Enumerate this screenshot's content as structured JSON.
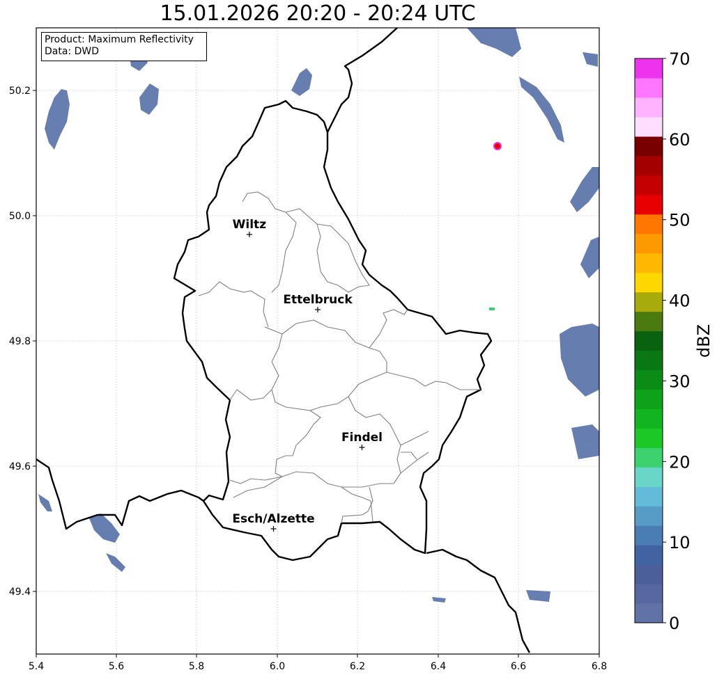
{
  "title": "15.01.2026 20:20 - 20:24 UTC",
  "info": {
    "product": "Product: Maximum Reflectivity",
    "data": "Data: DWD"
  },
  "map": {
    "xlim": [
      5.4,
      6.8
    ],
    "ylim": [
      49.3,
      50.3
    ],
    "x_ticks": [
      "5.4",
      "5.6",
      "5.8",
      "6.0",
      "6.2",
      "6.4",
      "6.6",
      "6.8"
    ],
    "y_ticks": [
      "49.4",
      "49.6",
      "49.8",
      "50.0",
      "50.2"
    ],
    "grid": true,
    "cities": [
      {
        "name": "Wiltz",
        "lon": 5.93,
        "lat": 49.97
      },
      {
        "name": "Ettelbruck",
        "lon": 6.1,
        "lat": 49.85
      },
      {
        "name": "Findel",
        "lon": 6.21,
        "lat": 49.63
      },
      {
        "name": "Esch/Alzette",
        "lon": 5.99,
        "lat": 49.5
      }
    ]
  },
  "colorbar": {
    "label": "dBZ",
    "min": 0,
    "max": 70,
    "tick_labels": [
      "0",
      "10",
      "20",
      "30",
      "40",
      "50",
      "60",
      "70"
    ],
    "colors": [
      "#6173a6",
      "#56689f",
      "#4b5f9b",
      "#4163a2",
      "#4a7db3",
      "#579cc6",
      "#62bcd9",
      "#6ad6c9",
      "#3dd26f",
      "#1bc826",
      "#12b520",
      "#0ea11a",
      "#0b8c16",
      "#097713",
      "#086210",
      "#4a7a10",
      "#a9ab0d",
      "#ffd700",
      "#ffb700",
      "#ff9900",
      "#ff7700",
      "#e60000",
      "#c40000",
      "#a50000",
      "#7a0000",
      "#ffddff",
      "#ffb2ff",
      "#ff77ff",
      "#ee33ee"
    ]
  }
}
